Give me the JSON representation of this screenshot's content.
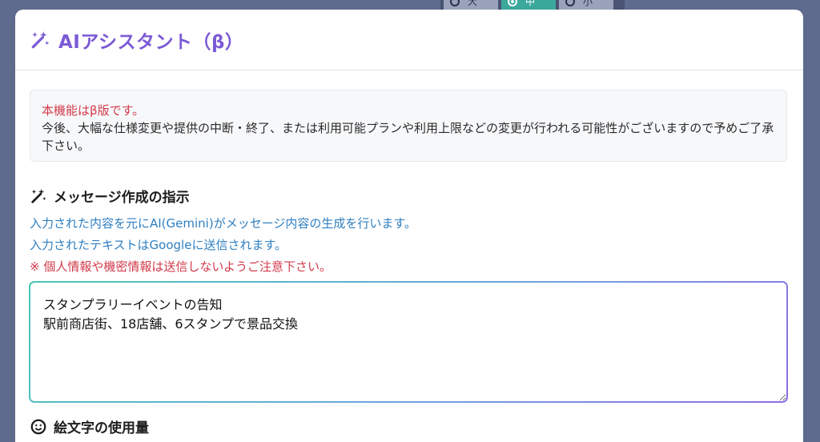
{
  "size_toggle": {
    "options": [
      {
        "label": "大",
        "selected": false
      },
      {
        "label": "中",
        "selected": true
      },
      {
        "label": "小",
        "selected": false
      }
    ]
  },
  "modal": {
    "title": "AIアシスタント（β）",
    "title_color": "#7b5ad6",
    "icon": "magic-wand-icon"
  },
  "notice": {
    "title": "本機能はβ版です。",
    "body": "今後、大幅な仕様変更や提供の中断・終了、または利用可能プランや利用上限などの変更が行われる可能性がございますので予めご了承下さい。"
  },
  "instruction_section": {
    "title": "メッセージ作成の指示",
    "icon": "magic-wand-icon",
    "desc_line1": "入力された内容を元にAI(Gemini)がメッセージ内容の生成を行います。",
    "desc_line2": "入力されたテキストはGoogleに送信されます。",
    "warning": "※ 個人情報や機密情報は送信しないようご注意下さい。",
    "prompt_value": "スタンプラリーイベントの告知\n駅前商店街、18店舗、6スタンプで景品交換"
  },
  "next_section": {
    "title": "絵文字の使用量",
    "icon": "emoji-icon"
  },
  "colors": {
    "accent": "#7b5ad6",
    "info_text": "#2f7fc1",
    "warning_text": "#d23a4a"
  }
}
